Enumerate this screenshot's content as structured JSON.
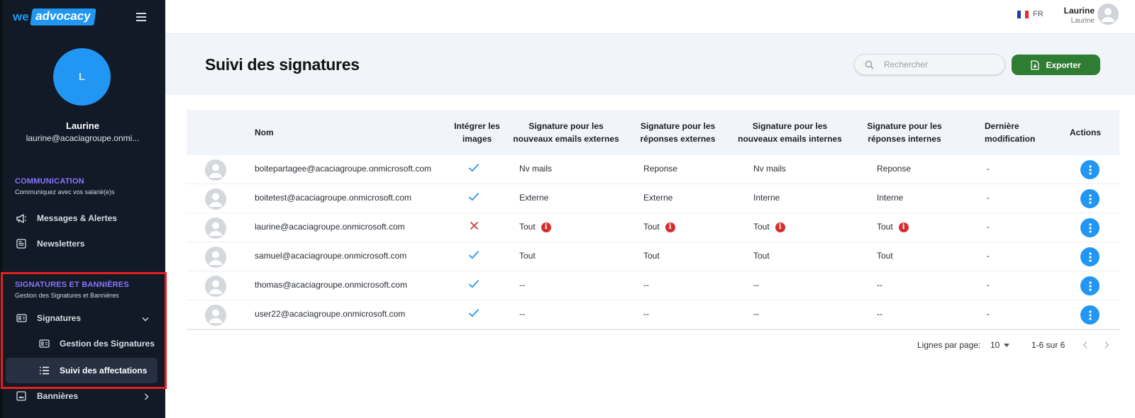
{
  "brand": {
    "part1": "we",
    "part2": "advocacy"
  },
  "sidebar": {
    "avatar_initial": "L",
    "user_name": "Laurine",
    "user_email": "laurine@acaciagroupe.onmi...",
    "sections": [
      {
        "title": "COMMUNICATION",
        "subtitle": "Communiquez avec vos salarié(e)s"
      },
      {
        "title": "SIGNATURES ET BANNIÈRES",
        "subtitle": "Gestion des Signatures et Bannières"
      }
    ],
    "items": {
      "messages": "Messages & Alertes",
      "newsletters": "Newsletters",
      "signatures": "Signatures",
      "gestion": "Gestion des Signatures",
      "suivi": "Suivi des affectations",
      "bannieres": "Bannières"
    }
  },
  "topbar": {
    "lang": "FR",
    "user_name": "Laurine",
    "user_sub": "Laurine"
  },
  "header": {
    "title": "Suivi des signatures",
    "search_placeholder": "Rechercher",
    "export_label": "Exporter"
  },
  "table": {
    "columns": {
      "nom": "Nom",
      "images_1": "Intégrer les",
      "images_2": "images",
      "ext_new_1": "Signature pour les",
      "ext_new_2": "nouveaux emails externes",
      "ext_rep_1": "Signature pour les",
      "ext_rep_2": "réponses externes",
      "int_new_1": "Signature pour les",
      "int_new_2": "nouveaux emails internes",
      "int_rep_1": "Signature pour les",
      "int_rep_2": "réponses internes",
      "modif_1": "Dernière",
      "modif_2": "modification",
      "actions": "Actions"
    },
    "rows": [
      {
        "email": "boitepartagee@acaciagroupe.onmicrosoft.com",
        "images": true,
        "ext_new": "Nv mails",
        "ext_rep": "Reponse",
        "int_new": "Nv mails",
        "int_rep": "Reponse",
        "modif": "-",
        "warn": false
      },
      {
        "email": "boitetest@acaciagroupe.onmicrosoft.com",
        "images": true,
        "ext_new": "Externe",
        "ext_rep": "Externe",
        "int_new": "Interne",
        "int_rep": "Interne",
        "modif": "-",
        "warn": false
      },
      {
        "email": "laurine@acaciagroupe.onmicrosoft.com",
        "images": false,
        "ext_new": "Tout",
        "ext_rep": "Tout",
        "int_new": "Tout",
        "int_rep": "Tout",
        "modif": "-",
        "warn": true
      },
      {
        "email": "samuel@acaciagroupe.onmicrosoft.com",
        "images": true,
        "ext_new": "Tout",
        "ext_rep": "Tout",
        "int_new": "Tout",
        "int_rep": "Tout",
        "modif": "-",
        "warn": false
      },
      {
        "email": "thomas@acaciagroupe.onmicrosoft.com",
        "images": true,
        "ext_new": "--",
        "ext_rep": "--",
        "int_new": "--",
        "int_rep": "--",
        "modif": "-",
        "warn": false
      },
      {
        "email": "user22@acaciagroupe.onmicrosoft.com",
        "images": true,
        "ext_new": "--",
        "ext_rep": "--",
        "int_new": "--",
        "int_rep": "--",
        "modif": "-",
        "warn": false
      }
    ],
    "info_glyph": "i"
  },
  "pagination": {
    "rows_label": "Lignes par page:",
    "rows_value": "10",
    "range": "1-6 sur 6"
  },
  "colors": {
    "sidebar_bg": "#111a26",
    "accent": "#2196f3",
    "section_title": "#8d73ff",
    "export_green": "#2e7d32",
    "error_red": "#d32f2f",
    "highlight_red": "#e32020"
  },
  "icons": [
    "hamburger-icon",
    "megaphone-icon",
    "newspaper-icon",
    "id-card-icon",
    "list-icon",
    "image-icon",
    "chevron-down-icon",
    "chevron-right-icon",
    "search-icon",
    "file-download-icon",
    "check-icon",
    "cross-icon",
    "info-icon",
    "more-vertical-icon",
    "person-icon",
    "flag-fr-icon",
    "chevron-left-icon"
  ]
}
